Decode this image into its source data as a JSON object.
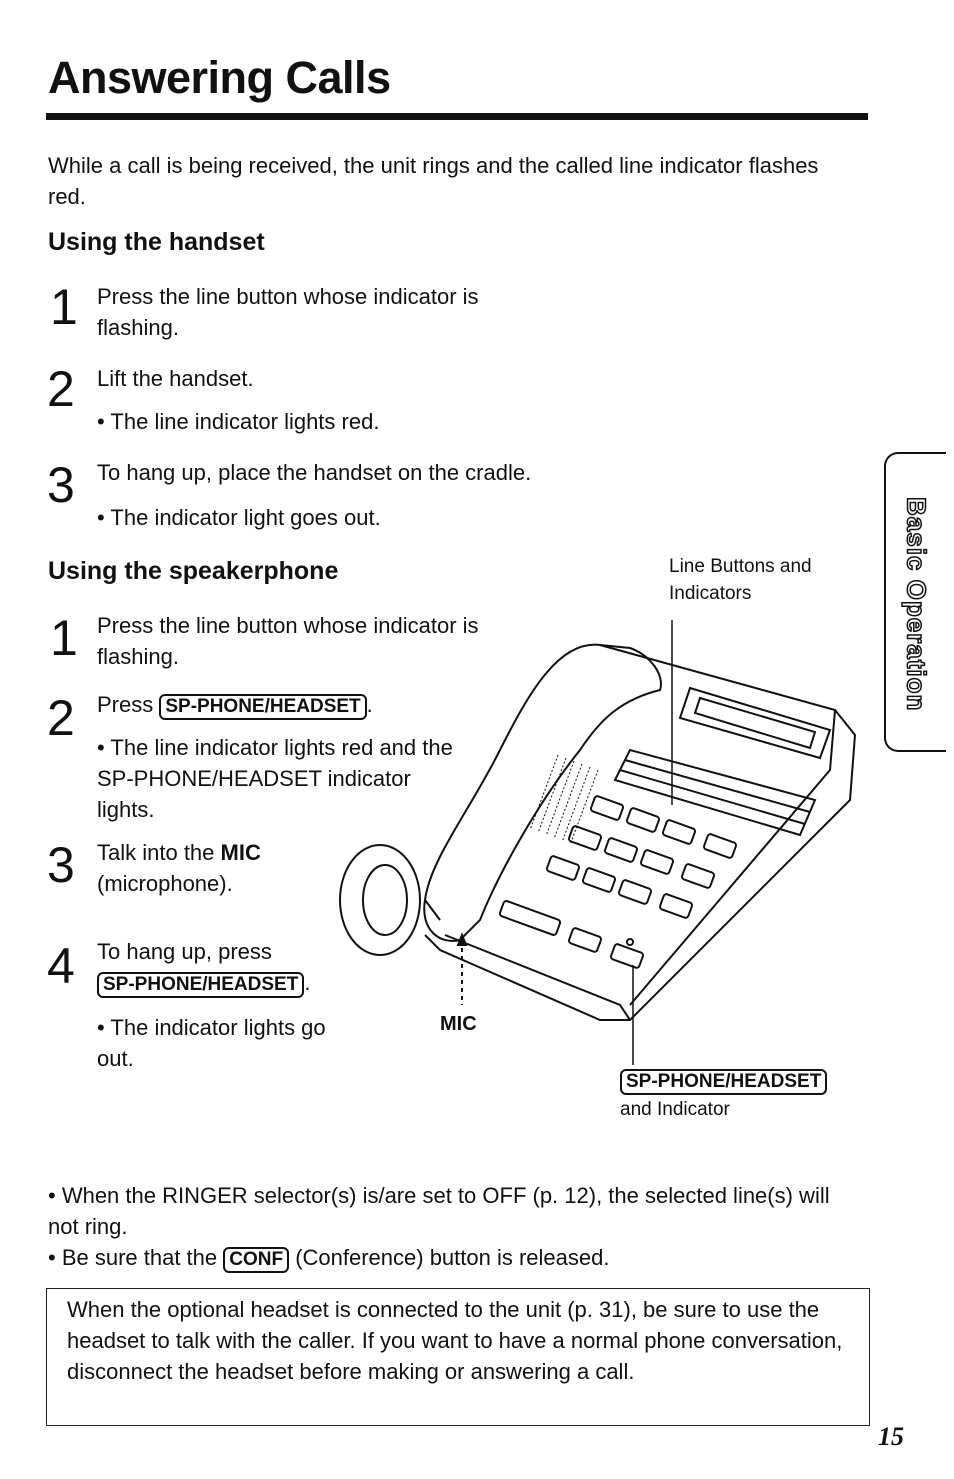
{
  "page": {
    "title": "Answering Calls",
    "intro": "While a call is being received, the unit rings and the called line indicator flashes red.",
    "side_tab": "Basic Operation",
    "page_number": "15"
  },
  "handset": {
    "heading": "Using the handset",
    "steps": [
      {
        "num": "1",
        "text": "Press the line button whose indicator is flashing."
      },
      {
        "num": "2",
        "text": "Lift the handset.",
        "bullet": "• The line indicator lights red."
      },
      {
        "num": "3",
        "text": "To hang up, place the handset on the cradle.",
        "bullet": "• The indicator light goes out."
      }
    ]
  },
  "speakerphone": {
    "heading": "Using the speakerphone",
    "steps": [
      {
        "num": "1",
        "text": "Press the line button whose indicator is flashing."
      },
      {
        "num": "2",
        "text_before": "Press ",
        "key": "SP-PHONE/HEADSET",
        "text_after": ".",
        "bullet": "• The line indicator lights red and the SP-PHONE/HEADSET indicator lights."
      },
      {
        "num": "3",
        "text_before": "Talk into the ",
        "bold": "MIC",
        "text_after": " (microphone)."
      },
      {
        "num": "4",
        "text_before": "To hang up, press ",
        "key": "SP-PHONE/HEADSET",
        "text_after": ".",
        "bullet": "• The indicator lights go out."
      }
    ]
  },
  "illustration": {
    "label_line_buttons": "Line Buttons and Indicators",
    "label_mic": "MIC",
    "label_sp_key": "SP-PHONE/HEADSET",
    "label_sp_suffix": "and Indicator"
  },
  "notes": {
    "bullet1": "• When the RINGER selector(s) is/are set to OFF (p. 12), the selected line(s) will not ring.",
    "bullet2_before": "• Be sure that the ",
    "bullet2_key": "CONF",
    "bullet2_after": " (Conference) button is released.",
    "box": "When the optional headset is connected to the unit (p. 31), be sure to use the headset to talk with the caller. If you want to have a normal phone conversation, disconnect the headset before making or answering a call."
  }
}
